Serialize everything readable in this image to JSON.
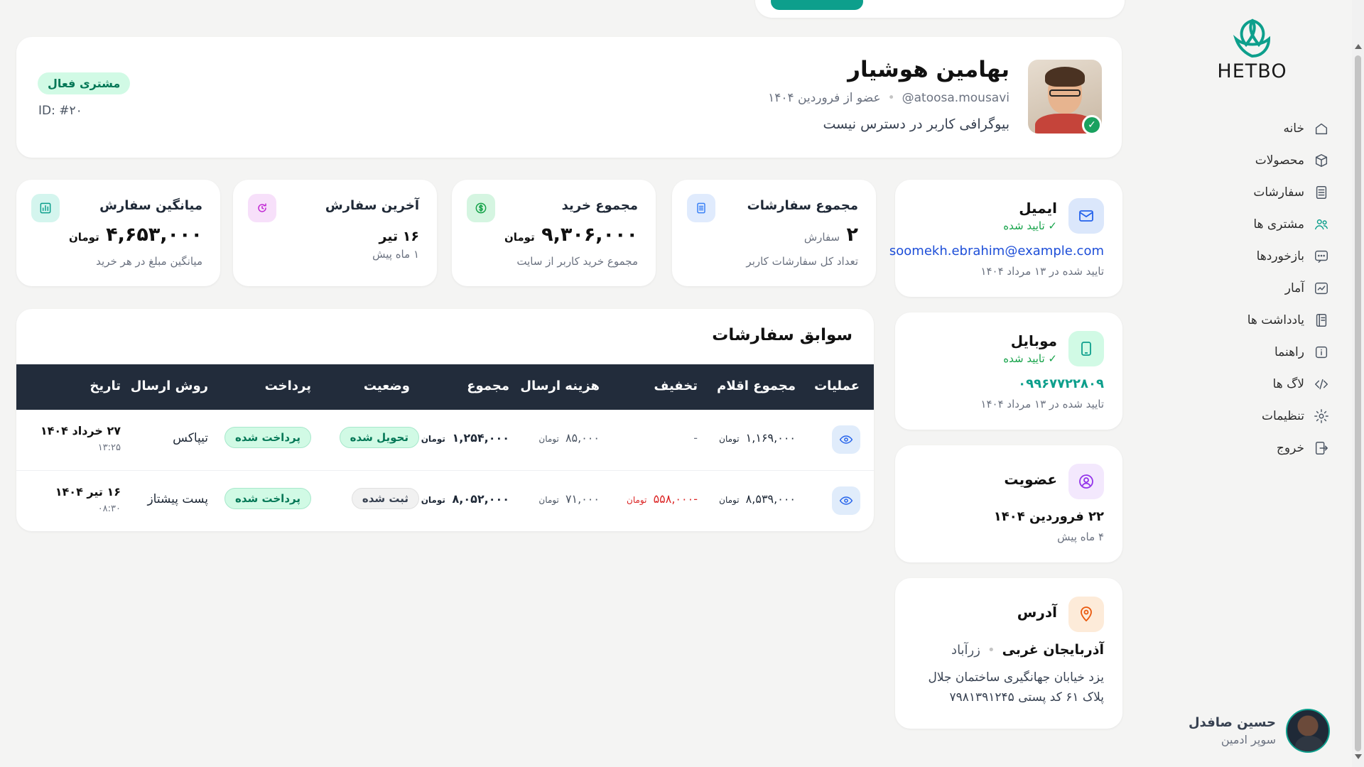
{
  "brand": {
    "name": "HETBO"
  },
  "sidebar": {
    "items": [
      {
        "label": "خانه",
        "icon": "home-icon"
      },
      {
        "label": "محصولات",
        "icon": "box-icon"
      },
      {
        "label": "سفارشات",
        "icon": "list-icon"
      },
      {
        "label": "مشتری ها",
        "icon": "users-icon"
      },
      {
        "label": "بازخوردها",
        "icon": "chat-icon"
      },
      {
        "label": "آمار",
        "icon": "chart-icon"
      },
      {
        "label": "یادداشت ها",
        "icon": "notebook-icon"
      },
      {
        "label": "راهنما",
        "icon": "info-icon"
      },
      {
        "label": "لاگ ها",
        "icon": "code-icon"
      },
      {
        "label": "تنظیمات",
        "icon": "gear-icon"
      },
      {
        "label": "خروج",
        "icon": "logout-icon"
      }
    ],
    "active_index": 3,
    "user": {
      "name": "حسین صافدل",
      "role": "سوپر ادمین"
    }
  },
  "profile": {
    "name": "بهامین هوشیار",
    "username": "@atoosa.mousavi",
    "member_since": "عضو از فروردین ۱۴۰۴",
    "bio": "بیوگرافی کاربر در دسترس نیست",
    "status_badge": "مشتری فعال",
    "id": "ID: #۲۰"
  },
  "contact": {
    "email": {
      "title": "ایمیل",
      "status": "✓ تایید شده",
      "value": "soomekh.ebrahim@example.com",
      "verified_at": "تایید شده در ۱۳ مرداد ۱۴۰۴"
    },
    "mobile": {
      "title": "موبایل",
      "status": "✓ تایید شده",
      "value": "۰۹۹۶۷۷۲۲۸۰۹",
      "verified_at": "تایید شده در ۱۳ مرداد ۱۴۰۴"
    },
    "membership": {
      "title": "عضویت",
      "date": "۲۲ فروردین ۱۴۰۴",
      "ago": "۴ ماه پیش"
    },
    "address": {
      "title": "آدرس",
      "province": "آذربایجان غربی",
      "city": "زرآباد",
      "line1": "یزد خیابان جهانگیری ساختمان جلال",
      "line2": "پلاک ۶۱ کد پستی ۷۹۸۱۳۹۱۲۴۵"
    }
  },
  "stats": [
    {
      "title": "مجموع سفارشات",
      "value": "۲",
      "unit": "سفارش",
      "sub": "تعداد کل سفارشات کاربر",
      "icon": "document-icon",
      "color": "#3b82f6"
    },
    {
      "title": "مجموع خرید",
      "value": "۹,۳۰۶,۰۰۰",
      "unit": "تومان",
      "sub": "مجموع خرید کاربر از سایت",
      "icon": "dollar-icon",
      "color": "#16a34a"
    },
    {
      "title": "آخرین سفارش",
      "value": "۱۶ تیر",
      "unit": "",
      "sub": "۱ ماه پیش",
      "icon": "refresh-icon",
      "color": "#c026d3"
    },
    {
      "title": "میانگین سفارش",
      "value": "۴,۶۵۳,۰۰۰",
      "unit": "تومان",
      "sub": "میانگین مبلغ در هر خرید",
      "icon": "bar-chart-icon",
      "color": "#0d9f8c"
    }
  ],
  "orders": {
    "title": "سوابق سفارشات",
    "columns": [
      "عملیات",
      "مجموع اقلام",
      "تخفیف",
      "هزینه ارسال",
      "مجموع",
      "وضعیت",
      "پرداخت",
      "روش ارسال",
      "تاریخ"
    ],
    "currency": "تومان",
    "rows": [
      {
        "items_total": "۱,۱۶۹,۰۰۰",
        "discount": "-",
        "shipping": "۸۵,۰۰۰",
        "total": "۱,۲۵۴,۰۰۰",
        "status": "تحویل شده",
        "payment": "پرداخت شده",
        "method": "تیپاکس",
        "date": "۲۷ خرداد ۱۴۰۴",
        "time": "۱۳:۲۵"
      },
      {
        "items_total": "۸,۵۳۹,۰۰۰",
        "discount": "-۵۵۸,۰۰۰",
        "shipping": "۷۱,۰۰۰",
        "total": "۸,۰۵۲,۰۰۰",
        "status": "ثبت شده",
        "payment": "پرداخت شده",
        "method": "پست پیشتاز",
        "date": "۱۶ تیر ۱۴۰۴",
        "time": "۰۸:۳۰"
      }
    ]
  },
  "colors": {
    "accent": "#0d9f8c",
    "header_dark": "#222c3b",
    "success": "#16a34a",
    "danger": "#dc2626"
  }
}
